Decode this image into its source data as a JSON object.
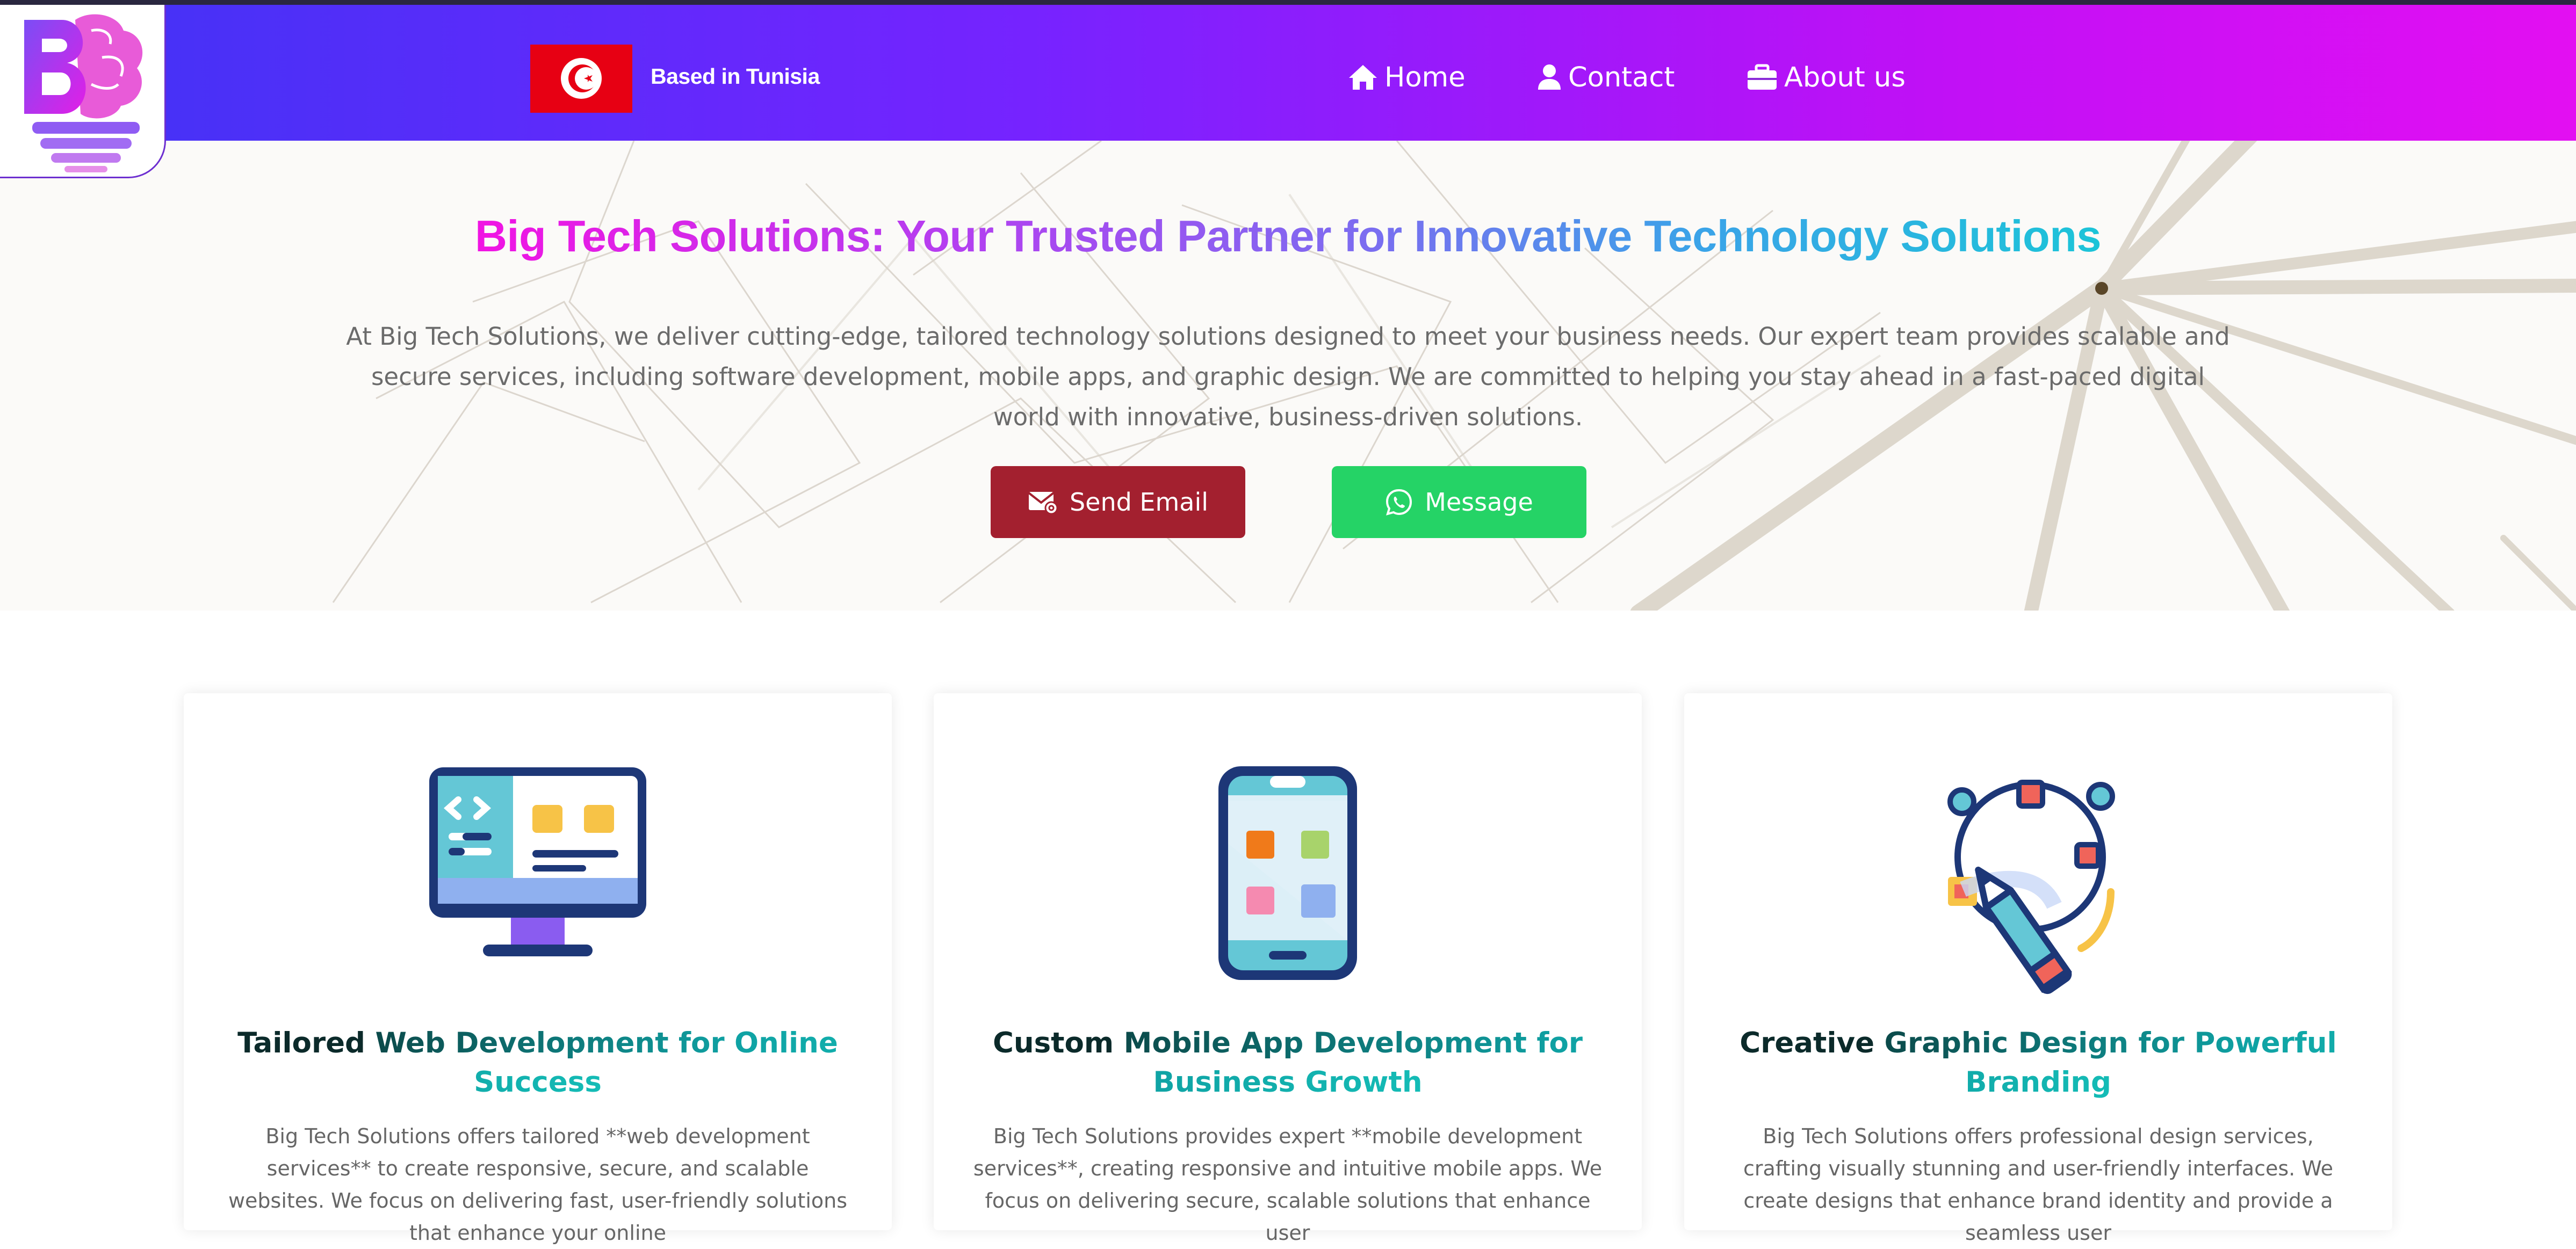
{
  "header": {
    "location_label": "Based in Tunisia",
    "nav": [
      {
        "label": "Home",
        "icon": "home-icon"
      },
      {
        "label": "Contact",
        "icon": "user-icon"
      },
      {
        "label": "About us",
        "icon": "briefcase-icon"
      }
    ],
    "colors": {
      "gradient_start": "#3f34f5",
      "gradient_end": "#e30ff2",
      "flag": "#e70013"
    }
  },
  "hero": {
    "title": "Big Tech Solutions: Your Trusted Partner for Innovative Technology Solutions",
    "description": "At Big Tech Solutions, we deliver cutting-edge, tailored technology solutions designed to meet your business needs. Our expert team provides scalable and secure services, including software development, mobile apps, and graphic design. We are committed to helping you stay ahead in a fast-paced digital world with innovative, business-driven solutions.",
    "buttons": {
      "email": {
        "label": "Send Email",
        "icon": "email-icon",
        "color": "#a3202f"
      },
      "message": {
        "label": "Message",
        "icon": "whatsapp-icon",
        "color": "#25d366"
      }
    }
  },
  "services": [
    {
      "icon": "desktop-web-icon",
      "title_dark": "Tailored ",
      "title_accent": "Web Development for Online Success",
      "description": "Big Tech Solutions offers tailored **web development services** to create responsive, secure, and scalable websites. We focus on delivering fast, user-friendly solutions that enhance your online"
    },
    {
      "icon": "mobile-app-icon",
      "title_dark": "Custom ",
      "title_accent": "Mobile App Development for Business Growth",
      "description": "Big Tech Solutions provides expert **mobile development services**, creating responsive and intuitive mobile apps. We focus on delivering secure, scalable solutions that enhance user"
    },
    {
      "icon": "graphic-design-pen-icon",
      "title_dark": "Creative ",
      "title_accent": "Graphic Design for Powerful Branding",
      "description": "Big Tech Solutions offers professional design services, crafting visually stunning and user-friendly interfaces. We create designs that enhance brand identity and provide a seamless user"
    }
  ]
}
